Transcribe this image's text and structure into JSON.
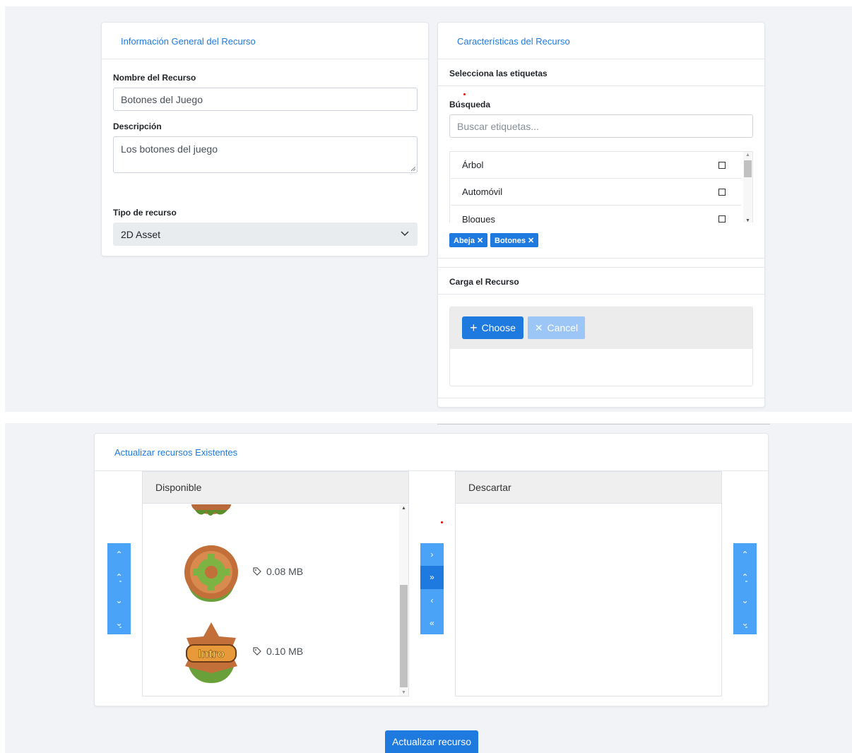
{
  "general_card": {
    "title": "Información General del Recurso",
    "name_label": "Nombre del Recurso",
    "name_value": "Botones del Juego",
    "desc_label": "Descripción",
    "desc_value": "Los botones del juego",
    "type_label": "Tipo de recurso",
    "type_value": "2D Asset"
  },
  "features_card": {
    "title": "Características del Recurso",
    "tags_header": "Selecciona las etiquetas",
    "search_label": "Búsqueda",
    "search_placeholder": "Buscar etiquetas...",
    "tags": [
      {
        "label": "Árbol"
      },
      {
        "label": "Automóvil"
      },
      {
        "label": "Bloques"
      }
    ],
    "selected_chips": [
      {
        "label": "Abeja ✕"
      },
      {
        "label": "Botones ✕"
      }
    ]
  },
  "upload_card": {
    "title": "Carga el Recurso",
    "choose_label": "Choose",
    "cancel_label": "Cancel"
  },
  "update_card": {
    "title": "Actualizar recursos Existentes",
    "available_header": "Disponible",
    "discard_header": "Descartar",
    "items": [
      {
        "size": "0.08 MB",
        "icon": "gear-badge-icon"
      },
      {
        "size": "0.10 MB",
        "icon": "intro-badge-icon"
      }
    ]
  },
  "submit_label": "Actualizar recurso",
  "colors": {
    "accent": "#1f7ae0",
    "control_bg": "#4aa3f7",
    "page_bg": "#f1f3f7"
  }
}
